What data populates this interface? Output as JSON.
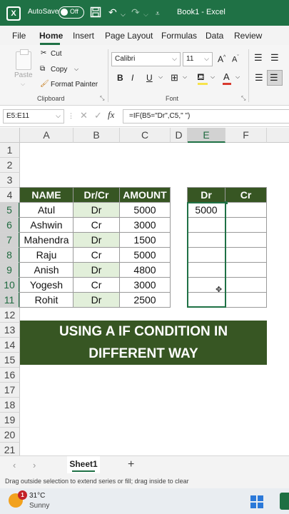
{
  "titlebar": {
    "autosave_label": "AutoSave",
    "toggle_state": "Off",
    "title": "Book1  -  Excel",
    "accent": "#1f7145"
  },
  "ribbon_tabs": [
    "File",
    "Home",
    "Insert",
    "Page Layout",
    "Formulas",
    "Data",
    "Review"
  ],
  "active_tab": "Home",
  "clipboard": {
    "paste_label": "Paste",
    "cut_label": "Cut",
    "copy_label": "Copy",
    "format_painter_label": "Format Painter",
    "group_label": "Clipboard"
  },
  "font_group": {
    "font_name": "Calibri",
    "font_size": "11",
    "group_label": "Font",
    "bold": "B",
    "italic": "I",
    "underline": "U"
  },
  "formula_bar": {
    "name_box": "E5:E11",
    "fx_label": "fx",
    "formula": "=IF(B5=\"Dr\",C5,\" \")"
  },
  "columns": [
    "A",
    "B",
    "C",
    "D",
    "E",
    "F"
  ],
  "rows": [
    "1",
    "2",
    "3",
    "4",
    "5",
    "6",
    "7",
    "8",
    "9",
    "10",
    "11",
    "12",
    "13",
    "14",
    "15",
    "16",
    "17",
    "18",
    "19",
    "20",
    "21"
  ],
  "table": {
    "headers": [
      "NAME",
      "Dr/Cr",
      "AMOUNT"
    ],
    "data": [
      [
        "Atul",
        "Dr",
        "5000"
      ],
      [
        "Ashwin",
        "Cr",
        "3000"
      ],
      [
        "Mahendra",
        "Dr",
        "1500"
      ],
      [
        "Raju",
        "Cr",
        "5000"
      ],
      [
        "Anish",
        "Dr",
        "4800"
      ],
      [
        "Yogesh",
        "Cr",
        "3000"
      ],
      [
        "Rohit",
        "Dr",
        "2500"
      ]
    ]
  },
  "result_table": {
    "headers": [
      "Dr",
      "Cr"
    ],
    "first_value": "5000"
  },
  "banner": {
    "line1": "USING A IF CONDITION IN",
    "line2": "DIFFERENT WAY",
    "color": "#375623"
  },
  "sheet_tabs": {
    "active": "Sheet1",
    "add_label": "+"
  },
  "status_bar": {
    "message": "Drag outside selection to extend series or fill; drag inside to clear"
  },
  "taskbar": {
    "badge": "1",
    "temperature": "31°C",
    "condition": "Sunny"
  }
}
